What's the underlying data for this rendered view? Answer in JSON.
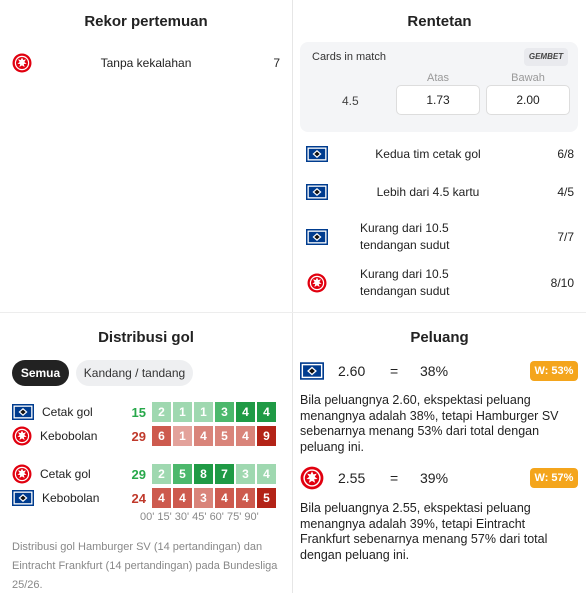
{
  "rekor": {
    "title": "Rekor pertemuan",
    "row": {
      "label": "Tanpa kekalahan",
      "value": "7",
      "team": "Eintracht Frankfurt"
    }
  },
  "rentetan": {
    "title": "Rentetan",
    "cards": {
      "label": "Cards in match",
      "bookmaker": "GEMBET",
      "line": "4.5",
      "over_label": "Atas",
      "under_label": "Bawah",
      "over_odds": "1.73",
      "under_odds": "2.00"
    },
    "streaks": [
      {
        "icon": "hsv-crest-icon",
        "label": "Kedua tim cetak gol",
        "value": "6/8"
      },
      {
        "icon": "hsv-crest-icon",
        "label": "Lebih dari 4.5 kartu",
        "value": "4/5"
      },
      {
        "icon": "hsv-crest-icon",
        "label": "Kurang dari 10.5 tendangan sudut",
        "value": "7/7"
      },
      {
        "icon": "eintracht-crest-icon",
        "label": "Kurang dari 10.5 tendangan sudut",
        "value": "8/10"
      }
    ]
  },
  "distribusi": {
    "title": "Distribusi gol",
    "tabs": {
      "all": "Semua",
      "home_away": "Kandang / tandang"
    },
    "teams": [
      {
        "icon": "hsv-crest-icon",
        "scored_label": "Cetak gol",
        "scored_total": "15",
        "scored": [
          "2",
          "1",
          "1",
          "3",
          "4",
          "4"
        ],
        "conceded_label": "Kebobolan",
        "conceded_total": "29",
        "conceded": [
          "6",
          "1",
          "4",
          "5",
          "4",
          "9"
        ]
      },
      {
        "icon": "eintracht-crest-icon",
        "scored_label": "Cetak gol",
        "scored_total": "29",
        "scored": [
          "2",
          "5",
          "8",
          "7",
          "3",
          "4"
        ],
        "conceded_label": "Kebobolan",
        "conceded_total": "24",
        "conceded": [
          "4",
          "4",
          "3",
          "4",
          "4",
          "5"
        ]
      }
    ],
    "times": "00' 15' 30' 45' 60' 75' 90'",
    "note": "Distribusi gol Hamburger SV (14 pertandingan) dan Eintracht Frankfurt (14 pertandingan) pada Bundesliga 25/26.",
    "colors": {
      "green_light": "#9fd8b0",
      "green_mid": "#4cb86c",
      "green_dark": "#1f9a45",
      "red_light": "#e3a29b",
      "red_mid": "#cd5a4e",
      "red_dark": "#b32317"
    }
  },
  "peluang": {
    "title": "Peluang",
    "teams": [
      {
        "icon": "hsv-crest-icon",
        "odds": "2.60",
        "eq": "=",
        "pct": "38%",
        "badge": "W: 53%",
        "text": "Bila peluangnya 2.60, ekspektasi peluang menangnya adalah 38%, tetapi Hamburger SV sebenarnya menang 53% dari total dengan peluang ini."
      },
      {
        "icon": "eintracht-crest-icon",
        "odds": "2.55",
        "eq": "=",
        "pct": "39%",
        "badge": "W: 57%",
        "text": "Bila peluangnya 2.55, ekspektasi peluang menangnya adalah 39%, tetapi Eintracht Frankfurt sebenarnya menang 57% dari total dengan peluang ini."
      }
    ],
    "badge_color": "#f4a51c"
  }
}
